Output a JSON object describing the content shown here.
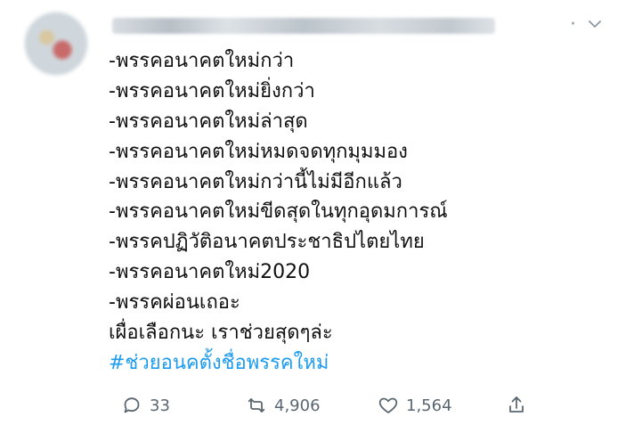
{
  "tweet": {
    "content_lines": [
      "-พรรคอนาคตใหม่กว่า",
      "-พรรคอนาคตใหม่ยิ่งกว่า",
      "-พรรคอนาคตใหม่ล่าสุด",
      "-พรรคอนาคตใหม่หมดจดทุกมุมมอง",
      "-พรรคอนาคตใหม่กว่านี้ไม่มีอีกแล้ว",
      "-พรรคอนาคตใหม่ขีดสุดในทุกอุดมการณ์",
      "-พรรคปฏิวัติอนาคตประชาธิปไตยไทย",
      "-พรรคอนาคตใหม่2020",
      "-พรรคผ่อนเถอะ",
      "เผื่อเลือกนะ เราช่วยสุดๆล่ะ"
    ],
    "hashtag": "#ช่วยอนคตั้งชื่อพรรคใหม่",
    "header_dot": "·",
    "actions": {
      "reply_count": "33",
      "retweet_count": "4,906",
      "like_count": "1,564"
    }
  },
  "icons": {
    "menu": "chevron-down-icon",
    "reply": "reply-icon",
    "retweet": "retweet-icon",
    "like": "heart-icon",
    "share": "share-icon"
  },
  "colors": {
    "text": "#111111",
    "hashtag": "#1d9bf0",
    "muted": "#5b6770"
  }
}
